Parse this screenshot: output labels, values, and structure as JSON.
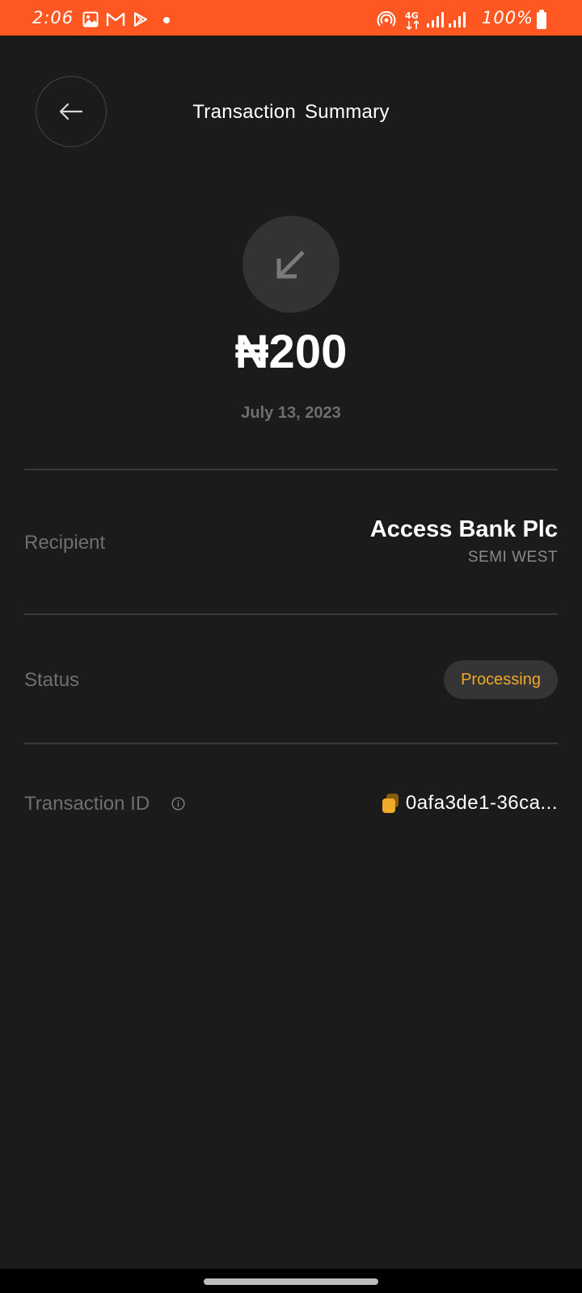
{
  "status_bar": {
    "time": "2:06",
    "battery": "100%",
    "icons": [
      "gallery-icon",
      "gmail-icon",
      "play-store-icon",
      "notification-dot",
      "hotspot-icon",
      "network-4g-icon",
      "signal-icon",
      "signal-icon",
      "battery-icon"
    ],
    "background_color": "#ff5722"
  },
  "header": {
    "title": "Transaction  Summary",
    "back_icon": "arrow-left-icon"
  },
  "transaction": {
    "direction_icon": "arrow-down-left-icon",
    "amount": "₦200",
    "date": "July 13, 2023"
  },
  "details": {
    "recipient": {
      "label": "Recipient",
      "name": "Access Bank Plc",
      "sub": "SEMI WEST"
    },
    "status": {
      "label": "Status",
      "value": "Processing",
      "color": "#f0a92a"
    },
    "transaction_id": {
      "label": "Transaction ID",
      "value": "0afa3de1-36ca...",
      "info_icon": "info-icon",
      "copy_icon": "copy-icon",
      "copy_color": "#f0a92a"
    }
  },
  "theme": {
    "background": "#1b1b1b",
    "muted_text": "#6f6f6f"
  }
}
